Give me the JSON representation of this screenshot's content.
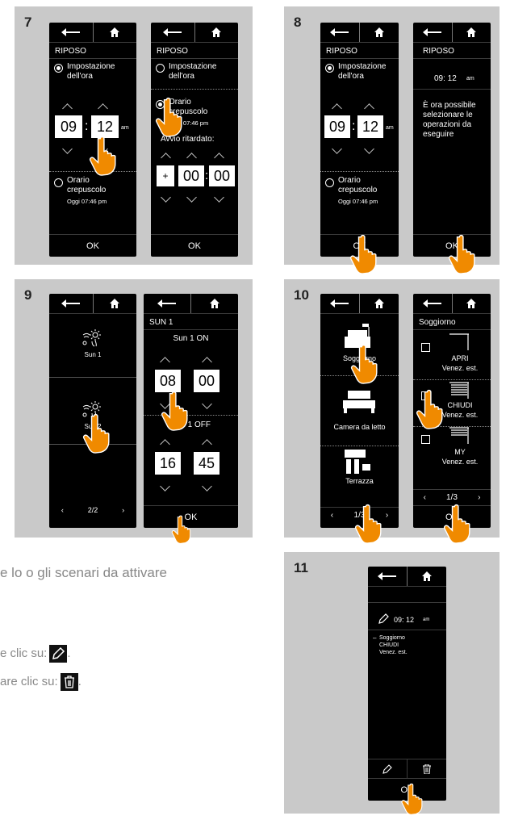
{
  "steps": [
    "7",
    "8",
    "9",
    "10",
    "11"
  ],
  "common": {
    "ok": "OK"
  },
  "p7a": {
    "title": "RIPOSO",
    "opt1": "Impostazione dell'ora",
    "hh": "09",
    "mm": "12",
    "ampm": "am",
    "opt2": "Orario crepuscolo",
    "opt2sub": "Oggi 07:46 pm"
  },
  "p7b": {
    "title": "RIPOSO",
    "opt1": "Impostazione dell'ora",
    "opt2": "Orario crepuscolo",
    "opt2sub": "Oggi 07:46 pm",
    "delay": "Avvio ritardato:",
    "sign": "+",
    "hh": "00",
    "mm": "00"
  },
  "p8a": {
    "title": "RIPOSO",
    "opt1": "Impostazione dell'ora",
    "hh": "09",
    "mm": "12",
    "ampm": "am",
    "opt2": "Orario crepuscolo",
    "opt2sub": "Oggi 07:46 pm"
  },
  "p8b": {
    "title": "RIPOSO",
    "time": "09: 12",
    "ampm": "am",
    "message": "È ora possibile selezionare le operazioni da eseguire"
  },
  "p9a": {
    "items": [
      "Sun 1",
      "Sun 2"
    ],
    "pager": "2/2"
  },
  "p9b": {
    "title": "SUN 1",
    "on": "Sun 1 ON",
    "on_hh": "08",
    "on_mm": "00",
    "off": "Sun 1 OFF",
    "off_hh": "16",
    "off_mm": "45"
  },
  "p10a": {
    "items": [
      "Soggiorno",
      "Camera da letto",
      "Terrazza"
    ],
    "pager": "1/3"
  },
  "p10b": {
    "title": "Soggiorno",
    "items": [
      {
        "a": "APRI",
        "b": "Venez. est."
      },
      {
        "a": "CHIUDI",
        "b": "Venez. est."
      },
      {
        "a": "MY",
        "b": "Venez. est."
      }
    ],
    "pager": "1/3"
  },
  "p11": {
    "time": "09: 12",
    "ampm": "am",
    "line1": "Soggiorno",
    "line2": "CHIUDI",
    "line3": "Venez. est."
  },
  "bg": {
    "line1": "e lo o gli scenari da attivare",
    "line2": "e clic su:",
    "line3": "are clic su:"
  },
  "colors": {
    "accent": "#f08a00",
    "panel": "#c9c9c9",
    "screen": "#000000"
  }
}
